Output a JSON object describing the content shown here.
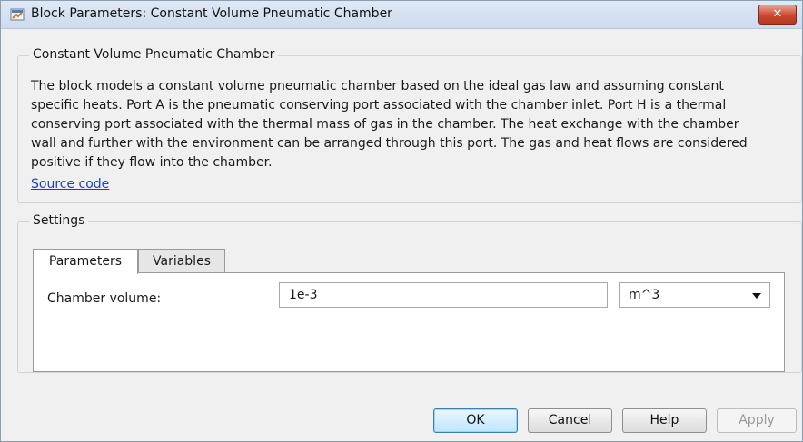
{
  "window": {
    "title": "Block Parameters: Constant Volume Pneumatic Chamber",
    "close_glyph": "✕"
  },
  "block": {
    "name": "Constant Volume Pneumatic Chamber",
    "description_lines": [
      "The block models a constant volume pneumatic chamber based on the ideal gas law and assuming constant",
      "specific heats. Port A is the pneumatic conserving port associated with the chamber inlet. Port H is a thermal",
      "conserving port associated with the thermal mass of gas in the chamber. The heat exchange with the chamber",
      "wall and further with the environment can be arranged through this port. The gas and heat flows are considered",
      "positive if they flow into the chamber."
    ],
    "source_link": "Source code"
  },
  "settings": {
    "label": "Settings",
    "tabs": [
      {
        "label": "Parameters",
        "active": true
      },
      {
        "label": "Variables",
        "active": false
      }
    ],
    "parameters": [
      {
        "label": "Chamber volume:",
        "value": "1e-3",
        "unit": "m^3"
      }
    ]
  },
  "buttons": {
    "ok": "OK",
    "cancel": "Cancel",
    "help": "Help",
    "apply": "Apply"
  },
  "icons": {
    "window_icon": "simulink-block-icon",
    "close": "close-icon",
    "dropdown": "chevron-down-icon"
  },
  "colors": {
    "link": "#1a3ecf",
    "close_button": "#c9482f",
    "default_button_border": "#3c7fb1"
  }
}
